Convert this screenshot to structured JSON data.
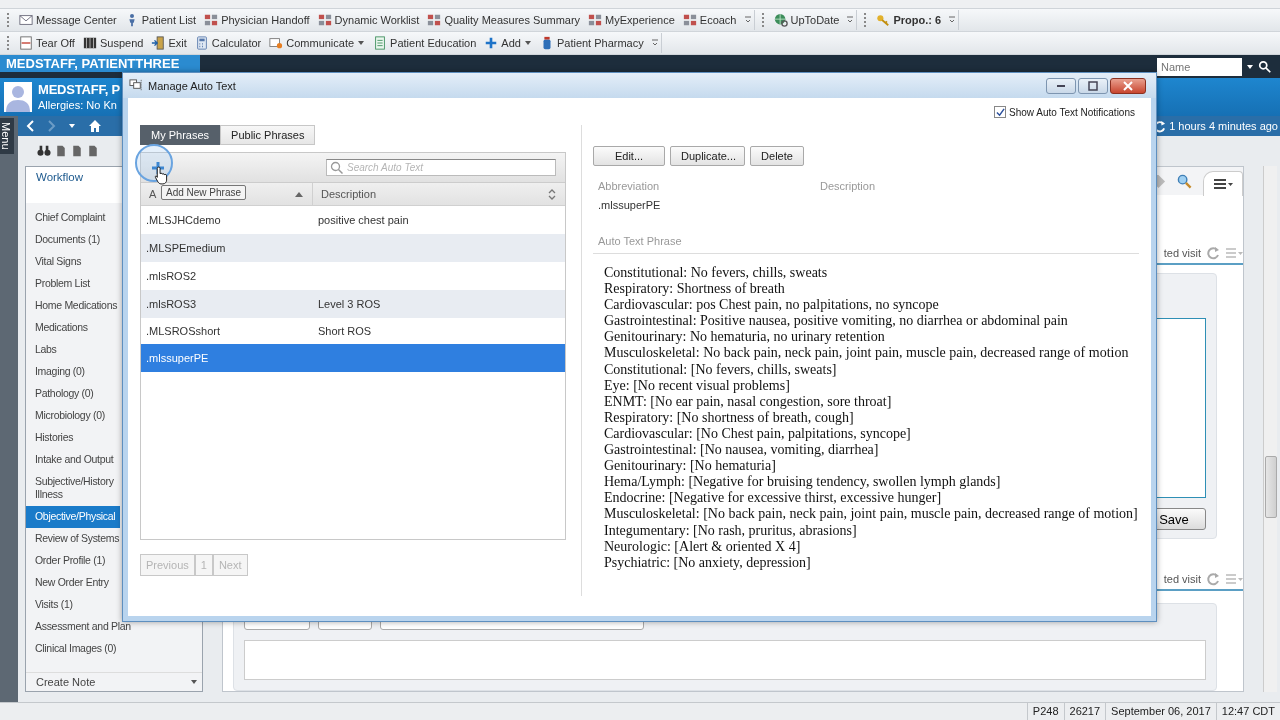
{
  "toolbars": [
    {
      "groups": [
        {
          "items": [
            {
              "label": "Message Center",
              "menu": false,
              "bold": false
            },
            {
              "label": "Patient List",
              "menu": false,
              "bold": false
            },
            {
              "label": "Physician Handoff",
              "menu": false,
              "bold": false
            },
            {
              "label": "Dynamic Worklist",
              "menu": false,
              "bold": false
            },
            {
              "label": "Quality Measures Summary",
              "menu": false,
              "bold": false
            },
            {
              "label": "MyExperience",
              "menu": false,
              "bold": false
            },
            {
              "label": "Ecoach",
              "menu": false,
              "bold": false
            }
          ]
        },
        {
          "items": [
            {
              "label": "UpToDate",
              "menu": false,
              "bold": false
            }
          ]
        },
        {
          "items": [
            {
              "label": "Propo.: 6",
              "menu": false,
              "bold": true
            }
          ]
        }
      ]
    },
    {
      "groups": [
        {
          "items": [
            {
              "label": "Tear Off",
              "menu": false,
              "bold": false
            },
            {
              "label": "Suspend",
              "menu": false,
              "bold": false
            },
            {
              "label": "Exit",
              "menu": false,
              "bold": false
            },
            {
              "label": "Calculator",
              "menu": false,
              "bold": false
            },
            {
              "label": "Communicate",
              "menu": true,
              "bold": false
            },
            {
              "label": "Patient Education",
              "menu": false,
              "bold": false
            },
            {
              "label": "Add",
              "menu": true,
              "bold": false
            },
            {
              "label": "Patient Pharmacy",
              "menu": false,
              "bold": false
            }
          ]
        }
      ]
    }
  ],
  "patient": {
    "tab": "MEDSTAFF, PATIENTTHREE",
    "name": "MEDSTAFF, P",
    "allergies": "Allergies: No Kn",
    "search_placeholder": "Name",
    "updated": "1 hours 4 minutes ago"
  },
  "menu_tab": "Menu",
  "sidebar": {
    "title": "Workflow",
    "items": [
      {
        "label": "Chief Complaint",
        "selected": false
      },
      {
        "label": "Documents (1)",
        "selected": false
      },
      {
        "label": "Vital Signs",
        "selected": false
      },
      {
        "label": "Problem List",
        "selected": false
      },
      {
        "label": "Home Medications",
        "selected": false
      },
      {
        "label": "Medications",
        "selected": false
      },
      {
        "label": "Labs",
        "selected": false
      },
      {
        "label": "Imaging (0)",
        "selected": false
      },
      {
        "label": "Pathology (0)",
        "selected": false
      },
      {
        "label": "Microbiology (0)",
        "selected": false
      },
      {
        "label": "Histories",
        "selected": false
      },
      {
        "label": "Intake and Output",
        "selected": false
      },
      {
        "label": "Subjective/History Illness",
        "selected": false
      },
      {
        "label": "Objective/Physical",
        "selected": true
      },
      {
        "label": "Review of Systems",
        "selected": false
      },
      {
        "label": "Order Profile (1)",
        "selected": false
      },
      {
        "label": "New Order Entry",
        "selected": false
      },
      {
        "label": "Visits (1)",
        "selected": false
      },
      {
        "label": "Assessment and Plan",
        "selected": false
      },
      {
        "label": "Clinical Images (0)",
        "selected": false
      }
    ],
    "footer": "Create Note"
  },
  "chart": {
    "sections": [
      {
        "label": "ted visit"
      },
      {
        "label": "ted visit"
      }
    ],
    "save": "Save"
  },
  "status_bar": [
    "P248",
    "26217",
    "September 06, 2017",
    "12:47 CDT"
  ],
  "dialog": {
    "title": "Manage Auto Text",
    "notifications": {
      "label": "Show Auto Text Notifications",
      "checked": true
    },
    "tabs": [
      {
        "label": "My Phrases",
        "selected": true
      },
      {
        "label": "Public Phrases",
        "selected": false
      }
    ],
    "search": {
      "placeholder": "Search Auto Text"
    },
    "tooltip": "Add New Phrase",
    "columns": [
      "A",
      "Description"
    ],
    "rows": [
      {
        "abbreviation": ".MLSJHCdemo",
        "description": "positive chest pain",
        "selected": false
      },
      {
        "abbreviation": ".MLSPEmedium",
        "selected": false
      },
      {
        "abbreviation": ".mlsROS2",
        "selected": false
      },
      {
        "abbreviation": ".mlsROS3",
        "description": "Level 3 ROS",
        "selected": false
      },
      {
        "abbreviation": ".MLSROSshort",
        "description": "Short ROS",
        "selected": false
      },
      {
        "abbreviation": ".mlssuperPE",
        "selected": true
      }
    ],
    "pager": {
      "previous": "Previous",
      "page": "1",
      "next": "Next",
      "disabled": true
    },
    "actions": [
      "Edit...",
      "Duplicate...",
      "Delete"
    ],
    "detail": {
      "abbreviation_label": "Abbreviation",
      "description_label": "Description",
      "abbreviation": ".mlssuperPE",
      "phrase_label": "Auto Text Phrase",
      "phrase_lines": [
        "Constitutional: No fevers, chills, sweats",
        "Respiratory: Shortness of breath",
        "Cardiovascular: pos Chest pain, no palpitations, no syncope",
        "Gastrointestinal: Positive nausea, positive vomiting, no diarrhea or abdominal pain",
        "Genitourinary: No hematuria, no urinary retention",
        "Musculoskeletal: No back pain, neck pain, joint pain, muscle pain, decreased range of motion",
        "Constitutional: [No fevers, chills, sweats]",
        "Eye: [No recent visual problems]",
        "ENMT: [No ear pain, nasal congestion, sore throat]",
        "Respiratory: [No shortness of breath, cough]",
        "Cardiovascular: [No Chest pain, palpitations, syncope]",
        "Gastrointestinal: [No nausea, vomiting, diarrhea]",
        "Genitourinary: [No hematuria]",
        "Hema/Lymph: [Negative for bruising tendency, swollen lymph glands]",
        "Endocrine: [Negative for excessive thirst, excessive hunger]",
        "Musculoskeletal: [No back pain, neck pain, joint pain, muscle pain, decreased range of motion]",
        "Integumentary: [No rash, pruritus, abrasions]",
        "Neurologic: [Alert & oriented X 4]",
        "Psychiatric: [No anxiety, depression]"
      ]
    }
  }
}
